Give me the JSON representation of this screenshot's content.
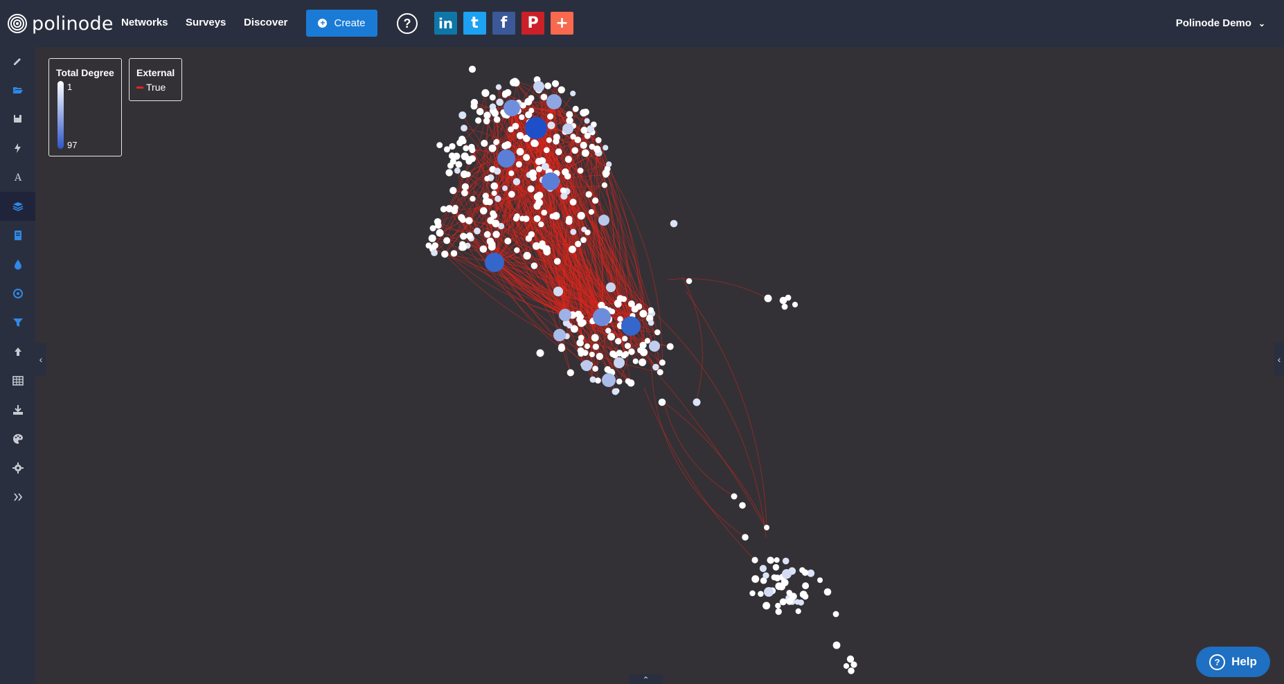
{
  "brand": {
    "name": "polinode"
  },
  "nav": {
    "links": [
      "Networks",
      "Surveys",
      "Discover"
    ],
    "create_label": "Create",
    "help_symbol": "?",
    "user_menu": "Polinode Demo",
    "social": [
      {
        "name": "linkedin-icon",
        "glyph": "in",
        "color": "#0e76a8"
      },
      {
        "name": "twitter-icon",
        "glyph": "t",
        "color": "#1da1f2"
      },
      {
        "name": "facebook-icon",
        "glyph": "f",
        "color": "#3b5998"
      },
      {
        "name": "pinterest-icon",
        "glyph": "P",
        "color": "#cb2027"
      },
      {
        "name": "addthis-icon",
        "glyph": "+",
        "color": "#f8694d"
      }
    ]
  },
  "sidebar": {
    "icons": [
      "pencil-icon",
      "folder-open-icon",
      "save-icon",
      "bolt-icon",
      "font-icon",
      "layers-icon",
      "document-icon",
      "drop-icon",
      "target-icon",
      "filter-icon",
      "upload-icon",
      "table-icon",
      "download-icon",
      "palette-icon",
      "gear-icon",
      "double-chevron-right-icon"
    ],
    "active": "layers-icon"
  },
  "legend": {
    "degree_title": "Total Degree",
    "degree_min": "1",
    "degree_max": "97",
    "degree_colors": [
      "#ffffff",
      "#2f56c9"
    ],
    "external_title": "External",
    "external_item": "True",
    "edge_color": "#e0261c"
  },
  "help_button": {
    "label": "Help"
  },
  "colors": {
    "background": "#333136",
    "navbar": "#2a2f3f",
    "accent": "#1a7bd6"
  }
}
